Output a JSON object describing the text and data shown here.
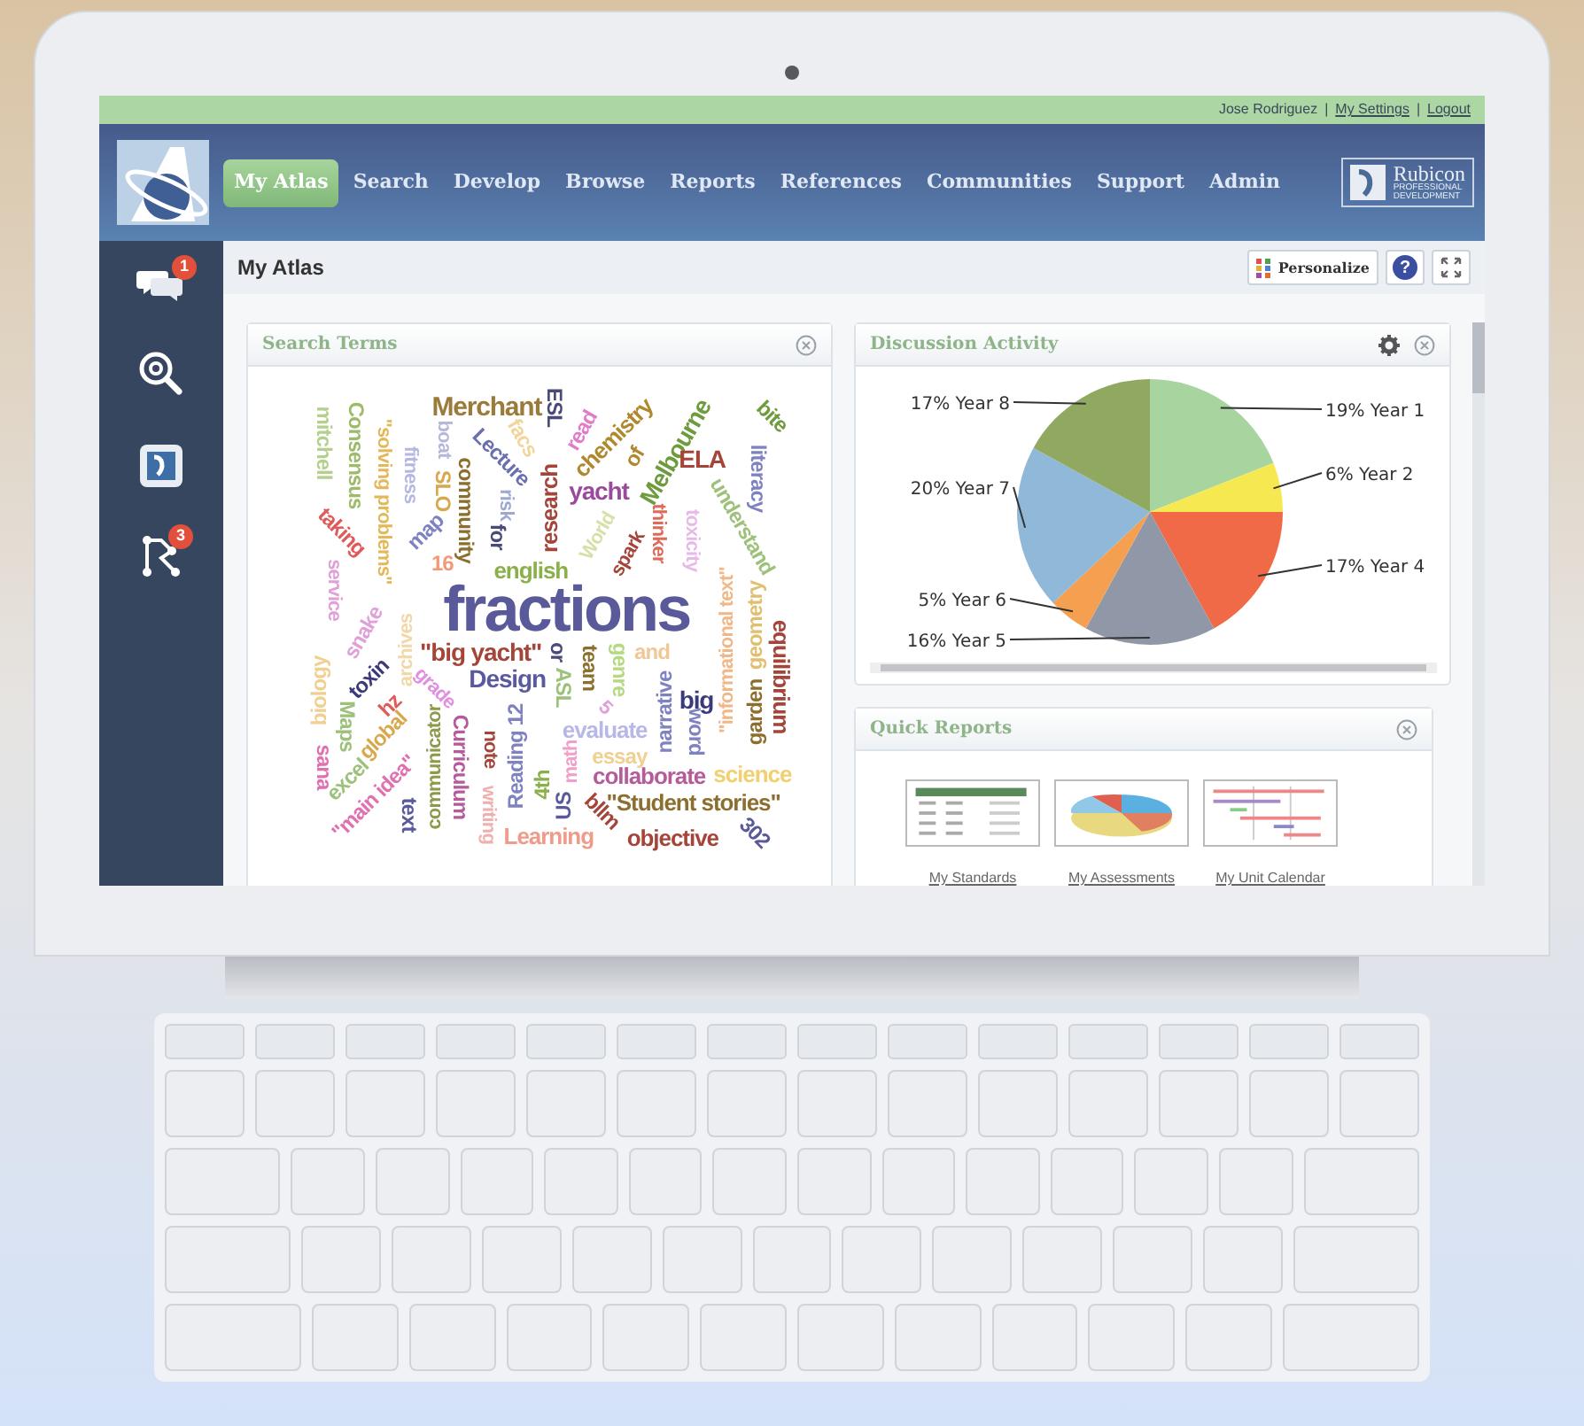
{
  "user_bar": {
    "user": "Jose Rodriguez",
    "separator": "|",
    "links": [
      "My Settings",
      "Logout"
    ]
  },
  "nav": [
    {
      "label": "My Atlas",
      "selected": true
    },
    {
      "label": "Search",
      "selected": false
    },
    {
      "label": "Develop",
      "selected": false
    },
    {
      "label": "Browse",
      "selected": false
    },
    {
      "label": "Reports",
      "selected": false
    },
    {
      "label": "References",
      "selected": false
    },
    {
      "label": "Communities",
      "selected": false
    },
    {
      "label": "Support",
      "selected": false
    },
    {
      "label": "Admin",
      "selected": false
    }
  ],
  "brand": {
    "name": "Rubicon",
    "tagline": [
      "PROFESSIONAL",
      "DEVELOPMENT"
    ]
  },
  "sidebar": [
    {
      "kind": "chat",
      "badge": "1"
    },
    {
      "kind": "search"
    },
    {
      "kind": "logo"
    },
    {
      "kind": "network",
      "badge": "3"
    }
  ],
  "page": {
    "title": "My Atlas",
    "personalize": "Personalize",
    "help": "?"
  },
  "search_terms": {
    "title": "Search Terms",
    "words": [
      {
        "text": "mitchell",
        "color": "#b5cf8f"
      },
      {
        "text": "Consensus",
        "color": "#9dbb6a"
      },
      {
        "text": "\"solving problems\"",
        "color": "#e3b85a"
      },
      {
        "text": "fitness",
        "color": "#b5b8e0"
      },
      {
        "text": "boat",
        "color": "#b6b8d8"
      },
      {
        "text": "SLO",
        "color": "#d7a84e"
      },
      {
        "text": "Merchant",
        "color": "#9c7a3a"
      },
      {
        "text": "ESL",
        "color": "#4a4a7a"
      },
      {
        "text": "facs",
        "color": "#f0d59c"
      },
      {
        "text": "Lecture",
        "color": "#6b6fb0"
      },
      {
        "text": "read",
        "color": "#e07cc8"
      },
      {
        "text": "chemistry",
        "color": "#b0882d"
      },
      {
        "text": "Melbourne",
        "color": "#6d9b3d"
      },
      {
        "text": "bite",
        "color": "#6d9b3d"
      },
      {
        "text": "ELA",
        "color": "#a5453a"
      },
      {
        "text": "literacy",
        "color": "#7f82c0"
      },
      {
        "text": "understand",
        "color": "#9dc07a"
      },
      {
        "text": "of",
        "color": "#b0882d"
      },
      {
        "text": "yacht",
        "color": "#9a4a9a"
      },
      {
        "text": "World",
        "color": "#d6e0a8"
      },
      {
        "text": "risk",
        "color": "#9ea8d0"
      },
      {
        "text": "for",
        "color": "#4a4a7a"
      },
      {
        "text": "community",
        "color": "#8c6f2e"
      },
      {
        "text": "research",
        "color": "#a5453a"
      },
      {
        "text": "map",
        "color": "#7f82c0"
      },
      {
        "text": "taking",
        "color": "#e05a5a"
      },
      {
        "text": "thinker",
        "color": "#e06a5a"
      },
      {
        "text": "toxicity",
        "color": "#e8b8e8"
      },
      {
        "text": "spark",
        "color": "#a5453a"
      },
      {
        "text": "16",
        "color": "#f09a7a"
      },
      {
        "text": "english",
        "color": "#8ab04a"
      },
      {
        "text": "service",
        "color": "#e0a0d8"
      },
      {
        "text": "\"informational text\"",
        "color": "#f0b888"
      },
      {
        "text": "geometry",
        "color": "#e0c070"
      },
      {
        "text": "equilibrium",
        "color": "#a5453a"
      },
      {
        "text": "fractions",
        "color": "#5a5a9a"
      },
      {
        "text": "snake",
        "color": "#e0a0d8"
      },
      {
        "text": "archives",
        "color": "#f0d8a8"
      },
      {
        "text": "\"big yacht\"",
        "color": "#a5453a"
      },
      {
        "text": "or",
        "color": "#4a4a7a"
      },
      {
        "text": "team",
        "color": "#8c6f2e"
      },
      {
        "text": "genre",
        "color": "#b5d880"
      },
      {
        "text": "and",
        "color": "#f0c898"
      },
      {
        "text": "Design",
        "color": "#5a5aa0"
      },
      {
        "text": "ASL",
        "color": "#9dc07a"
      },
      {
        "text": "biology",
        "color": "#f0d090"
      },
      {
        "text": "toxin",
        "color": "#3a3a7a"
      },
      {
        "text": "grade",
        "color": "#e090e0"
      },
      {
        "text": "narrative",
        "color": "#7f82c0"
      },
      {
        "text": "big",
        "color": "#3a3a7a"
      },
      {
        "text": "word",
        "color": "#7f82c0"
      },
      {
        "text": "5",
        "color": "#e0a0d8"
      },
      {
        "text": "garden",
        "color": "#8c6f2e"
      },
      {
        "text": "hz",
        "color": "#e05a5a"
      },
      {
        "text": "Maps",
        "color": "#9dc07a"
      },
      {
        "text": "global",
        "color": "#d7a84e"
      },
      {
        "text": "communicator",
        "color": "#8c9a4a"
      },
      {
        "text": "Curriculum",
        "color": "#b55a9a"
      },
      {
        "text": "note",
        "color": "#a5453a"
      },
      {
        "text": "Reading 12",
        "color": "#7f82c0"
      },
      {
        "text": "evaluate",
        "color": "#b8b8e8"
      },
      {
        "text": "essay",
        "color": "#f0d090"
      },
      {
        "text": "collaborate",
        "color": "#b55a9a"
      },
      {
        "text": "science",
        "color": "#f0d070"
      },
      {
        "text": "sana",
        "color": "#e070b0"
      },
      {
        "text": "excel",
        "color": "#9dc07a"
      },
      {
        "text": "\"main idea\"",
        "color": "#e070b0"
      },
      {
        "text": "text",
        "color": "#5a5a9a"
      },
      {
        "text": "writing",
        "color": "#f0b0b0"
      },
      {
        "text": "4th",
        "color": "#8ab04a"
      },
      {
        "text": "US",
        "color": "#5a5a9a"
      },
      {
        "text": "math",
        "color": "#f0a0c8"
      },
      {
        "text": "bllm",
        "color": "#a5453a"
      },
      {
        "text": "\"Student stories\"",
        "color": "#8c6f2e"
      },
      {
        "text": "Learning",
        "color": "#f09a8a"
      },
      {
        "text": "objective",
        "color": "#a5453a"
      },
      {
        "text": "302",
        "color": "#5a5a9a"
      }
    ]
  },
  "discussion": {
    "title": "Discussion Activity",
    "chart_data": {
      "type": "pie",
      "values": [
        19,
        6,
        17,
        16,
        5,
        20,
        17
      ],
      "colors": [
        "#a8d4a0",
        "#f5e850",
        "#f06a48",
        "#9098a8",
        "#f5a050",
        "#90b8d8",
        "#90a860"
      ],
      "value_labels": [
        "19% Year 1",
        "6% Year 2",
        "17% Year 4",
        "16% Year 5",
        "5% Year 6",
        "20% Year 7",
        "17% Year 8"
      ]
    }
  },
  "quick_reports": {
    "title": "Quick Reports",
    "reports": [
      {
        "kind": "table",
        "label": "My Standards"
      },
      {
        "kind": "pie",
        "label": "My Assessments"
      },
      {
        "kind": "gantt",
        "label": "My Unit Calendar"
      }
    ]
  }
}
